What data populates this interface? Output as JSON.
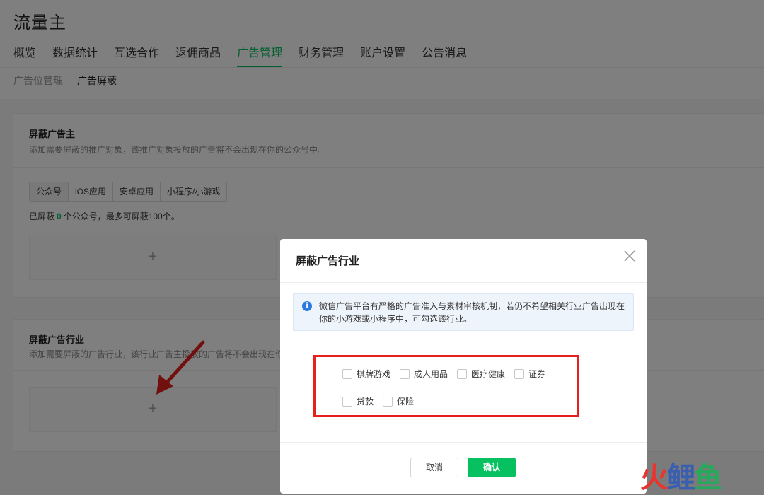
{
  "app": {
    "title": "流量主"
  },
  "main_nav": {
    "items": [
      {
        "label": "概览",
        "active": false
      },
      {
        "label": "数据统计",
        "active": false
      },
      {
        "label": "互选合作",
        "active": false
      },
      {
        "label": "返佣商品",
        "active": false
      },
      {
        "label": "广告管理",
        "active": true
      },
      {
        "label": "财务管理",
        "active": false
      },
      {
        "label": "账户设置",
        "active": false
      },
      {
        "label": "公告消息",
        "active": false
      }
    ]
  },
  "sub_nav": {
    "items": [
      {
        "label": "广告位管理",
        "active": false
      },
      {
        "label": "广告屏蔽",
        "active": true
      }
    ]
  },
  "block_advertiser": {
    "title": "屏蔽广告主",
    "desc": "添加需要屏蔽的推广对象，该推广对象投放的广告将不会出现在你的公众号中。",
    "tabs": [
      "公众号",
      "iOS应用",
      "安卓应用",
      "小程序/小游戏"
    ],
    "count_prefix": "已屏蔽",
    "count": "0",
    "count_suffix": "个公众号，最多可屏蔽100个。",
    "add_symbol": "+"
  },
  "block_industry": {
    "title": "屏蔽广告行业",
    "desc": "添加需要屏蔽的广告行业，该行业广告主投放的广告将不会出现在你",
    "add_symbol": "+"
  },
  "modal": {
    "title": "屏蔽广告行业",
    "notice_icon": "i",
    "notice": "微信广告平台有严格的广告准入与素材审核机制，若仍不希望相关行业广告出现在你的小游戏或小程序中，可勾选该行业。",
    "options": [
      "棋牌游戏",
      "成人用品",
      "医疗健康",
      "证券",
      "贷款",
      "保险"
    ],
    "cancel_label": "取消",
    "confirm_label": "确认",
    "highlight_color": "#e5201f"
  },
  "watermark": {
    "chars": [
      "火",
      "鲤",
      "鱼"
    ]
  },
  "colors": {
    "accent": "#07c160",
    "info": "#2c7be5",
    "annotation": "#e5201f"
  }
}
